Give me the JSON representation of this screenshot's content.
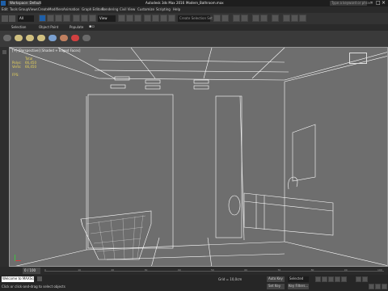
{
  "title_bar": {
    "workspace": "Workspace: Default",
    "app_title": "Autodesk 3ds Max 2016",
    "file_name": "Modern_Bathroom.max",
    "search_placeholder": "Type a keyword or phrase"
  },
  "menu": {
    "items": [
      "Edit",
      "Tools",
      "Group",
      "Views",
      "Create",
      "Modifiers",
      "Animation",
      "Graph Editors",
      "Rendering",
      "Civil View",
      "Customize",
      "Scripting",
      "Help"
    ]
  },
  "toolbar": {
    "selection_filter": "All",
    "view_dropdown": "View",
    "named_selection": "Create Selection Set"
  },
  "ribbon": {
    "tabs": [
      "Selection",
      "Object Paint",
      "Populate"
    ]
  },
  "viewport": {
    "label": "[+] [Perspective] [Shaded + Edged Faces]",
    "stats_total_label": "Total",
    "stats_polys_label": "Polys:",
    "stats_polys_value": "66,450",
    "stats_verts_label": "Verts:",
    "stats_verts_value": "66,450",
    "stats_fps_label": "FPS:"
  },
  "timeline": {
    "frame_counter": "0 / 100",
    "tick_labels": [
      "0",
      "10",
      "20",
      "30",
      "40",
      "50",
      "60",
      "70",
      "80",
      "90",
      "100"
    ]
  },
  "status": {
    "welcome": "Welcome to MAXScript.",
    "hint": "Click or click-and-drag to select objects",
    "grid": "Grid = 10,0cm",
    "auto_key": "Auto Key",
    "selected": "Selected",
    "set_key": "Set Key",
    "key_filters": "Key Filters..."
  },
  "colors": {
    "viewport_bg": "#6e6e6e",
    "wire": "#ffffff",
    "stats_yellow": "#e6d25a",
    "accent_blue": "#1e5fa8"
  }
}
